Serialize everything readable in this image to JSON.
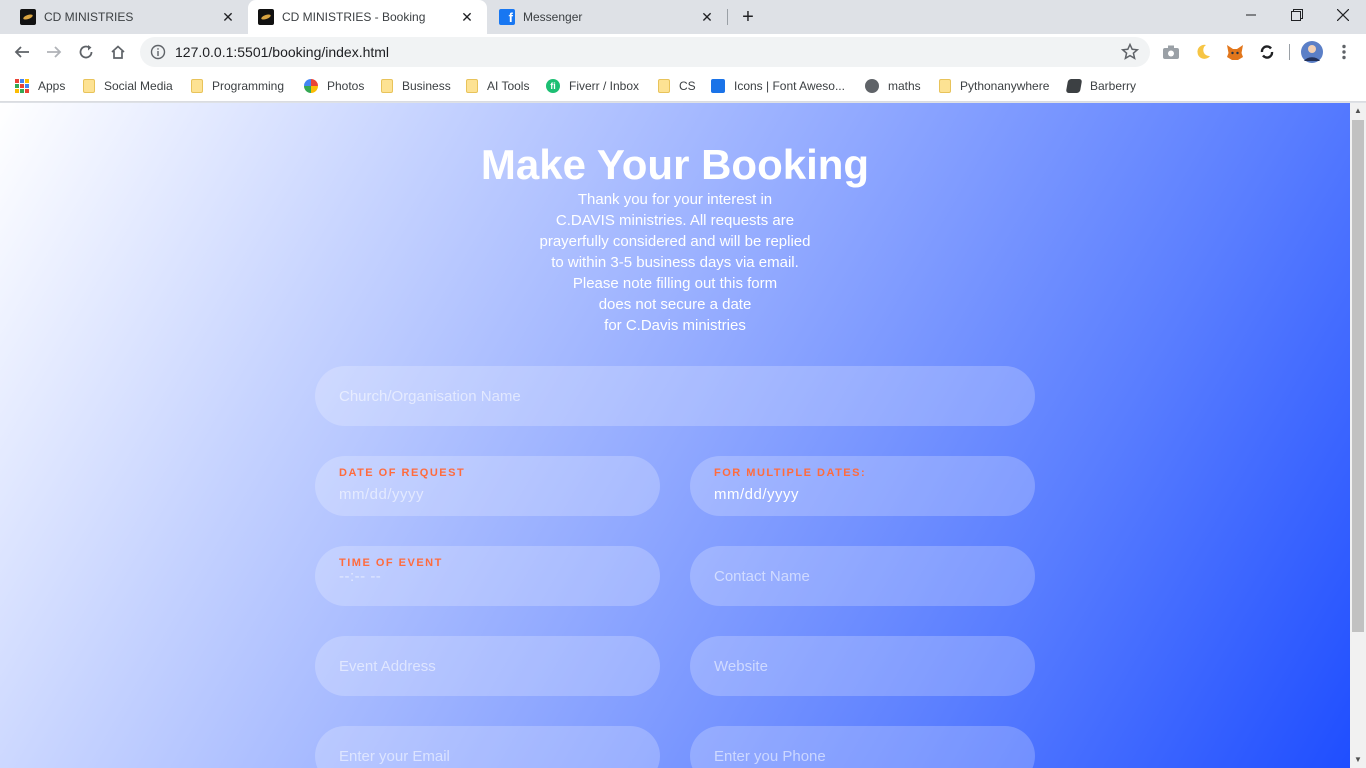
{
  "browser": {
    "tabs": [
      {
        "title": "CD MINISTRIES",
        "favicon": "cd-ministries-icon"
      },
      {
        "title": "CD MINISTRIES - Booking",
        "favicon": "cd-ministries-icon"
      },
      {
        "title": "Messenger",
        "favicon": "facebook-icon"
      }
    ],
    "url": "127.0.0.1:5501/booking/index.html",
    "bookmarks": [
      {
        "label": "Apps",
        "icon": "apps-grid-icon"
      },
      {
        "label": "Social Media",
        "icon": "folder-icon"
      },
      {
        "label": "Programming",
        "icon": "folder-icon"
      },
      {
        "label": "Photos",
        "icon": "google-photos-icon"
      },
      {
        "label": "Business",
        "icon": "folder-icon"
      },
      {
        "label": "AI Tools",
        "icon": "folder-icon"
      },
      {
        "label": "Fiverr / Inbox",
        "icon": "fiverr-icon"
      },
      {
        "label": "CS",
        "icon": "folder-icon"
      },
      {
        "label": "Icons | Font Aweso...",
        "icon": "flag-icon"
      },
      {
        "label": "maths",
        "icon": "globe-icon"
      },
      {
        "label": "Pythonanywhere",
        "icon": "folder-icon"
      },
      {
        "label": "Barberry",
        "icon": "barberry-icon"
      }
    ],
    "fiverr_glyph": "fi"
  },
  "page": {
    "title": "Make Your Booking",
    "intro_lines": [
      "Thank you for your interest in",
      "C.DAVIS ministries. All requests are",
      "prayerfully considered and will be replied",
      "to within 3-5 business days via email.",
      "Please note filling out this form",
      "does not secure a date",
      "for C.Davis ministries"
    ],
    "form": {
      "org_name_placeholder": "Church/Organisation Name",
      "date_request_label": "DATE OF REQUEST",
      "date_request_value": "mm/dd/yyyy",
      "multiple_dates_label": "FOR MULTIPLE DATES:",
      "multiple_dates_value": "mm/dd/yyyy",
      "time_label": "TIME OF EVENT",
      "time_value": "--:-- --",
      "contact_placeholder": "Contact Name",
      "address_placeholder": "Event Address",
      "website_placeholder": "Website",
      "email_placeholder": "Enter your Email",
      "phone_placeholder": "Enter you Phone"
    }
  },
  "colors": {
    "label_accent": "#ff6b3d",
    "gradient_start": "#ffffff",
    "gradient_end": "#1f4eff"
  }
}
